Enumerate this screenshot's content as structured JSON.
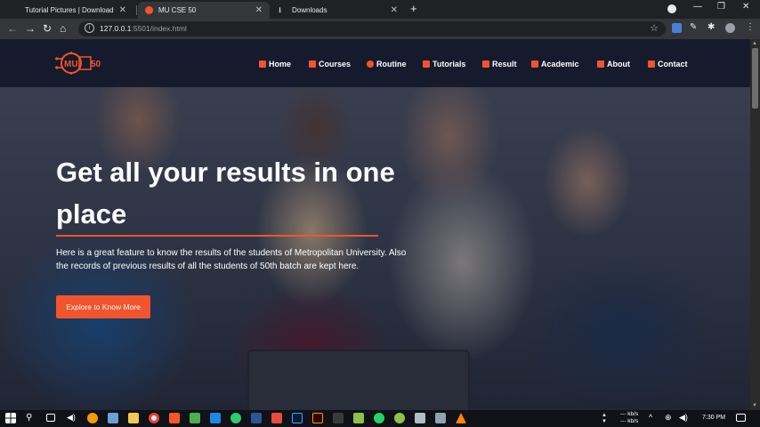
{
  "browser": {
    "tabs": [
      {
        "title": "Tutorial Pictures | Download Free",
        "active": false
      },
      {
        "title": "MU CSE 50",
        "active": true
      },
      {
        "title": "Downloads",
        "active": false
      }
    ],
    "url_host": "127.0.0.1",
    "url_path": ":5501/index.html",
    "icons": [
      "back-arrow-icon",
      "forward-arrow-icon",
      "reload-icon",
      "home-icon",
      "star-icon",
      "extensions-icon"
    ]
  },
  "site": {
    "logo_text": "MU",
    "logo_number": "50",
    "nav": [
      {
        "label": "Home",
        "icon": "home-icon"
      },
      {
        "label": "Courses",
        "icon": "book-icon"
      },
      {
        "label": "Routine",
        "icon": "clock-icon"
      },
      {
        "label": "Tutorials",
        "icon": "chat-icon"
      },
      {
        "label": "Result",
        "icon": "result-icon"
      },
      {
        "label": "Academic",
        "icon": "building-icon"
      },
      {
        "label": "About",
        "icon": "id-card-icon"
      },
      {
        "label": "Contact",
        "icon": "contact-icon"
      }
    ],
    "accent": "#f2542d"
  },
  "hero": {
    "title": "Get all your results in one place",
    "description": "Here is a great feature to know the results of the students of Metropolitan University. Also the records of previous results of all the students of 50th batch are kept here.",
    "cta_label": "Explore to Know More"
  },
  "taskbar": {
    "net_up": "--- kb/s",
    "net_down": "--- kb/s",
    "time": "7:30 PM"
  }
}
